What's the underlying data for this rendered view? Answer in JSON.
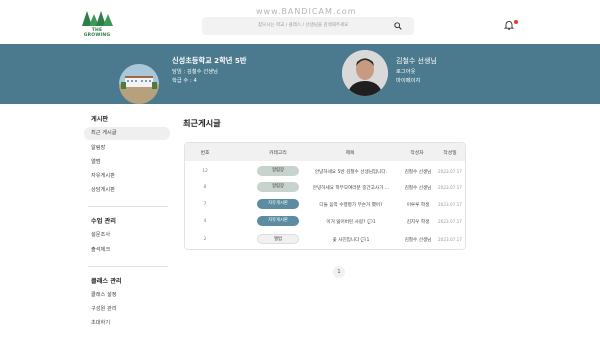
{
  "header": {
    "logo_text": "THE GROWING",
    "search_placeholder": "찾으시는 학교 / 클래스 / 선생님을 검색해주세요",
    "watermark": "www.BANDICAM.com"
  },
  "banner": {
    "school_name": "신성초등학교 2학년 5반",
    "homeroom": "담임 : 김철수 선생님",
    "student_count": "학급 수 : 4",
    "teacher_name": "김철수 선생님",
    "logout": "로그아웃",
    "mypage": "마이페이지"
  },
  "sidebar": {
    "board_title": "게시판",
    "board_items": [
      "최근 게시글",
      "알림장",
      "앨범",
      "자유게시판",
      "상담게시판"
    ],
    "class_title": "수업 관리",
    "class_items": [
      "설문조사",
      "출석체크"
    ],
    "manage_title": "클래스 관리",
    "manage_items": [
      "클래스 설정",
      "구성원 관리",
      "초대하기"
    ]
  },
  "main": {
    "title": "최근게시글",
    "columns": [
      "번호",
      "카테고리",
      "제목",
      "작성자",
      "작성일"
    ],
    "rows": [
      {
        "no": "12",
        "category": "알림장",
        "title": "안녕하세요 5반 김철수 선생님입니다.",
        "author": "김철수 선생님",
        "date": "2023.07.17"
      },
      {
        "no": "8",
        "category": "알림장",
        "title": "안녕하세요 학부모여러분 중간고사가 ...",
        "author": "김철수 선생님",
        "date": "2023.07.17"
      },
      {
        "no": "7",
        "category": "자유게시판",
        "title": "다들 음악 수행평가 무슨거 했어?",
        "author": "이루루 학생",
        "date": "2023.07.17"
      },
      {
        "no": "4",
        "category": "자유게시판",
        "title": "이거 잃어버린 사람? 💬1",
        "author": "김지우 학생",
        "date": "2023.07.17"
      },
      {
        "no": "2",
        "category": "앨범",
        "title": "꽃 사진입니다 💬1",
        "author": "김철수 선생님",
        "date": "2023.07.17"
      }
    ],
    "page": "1"
  },
  "colors": {
    "banner": "#4b7a8e",
    "badge_notice": "#c7d3cd",
    "badge_free": "#5b8ca1",
    "badge_album": "#f1f1f1"
  }
}
